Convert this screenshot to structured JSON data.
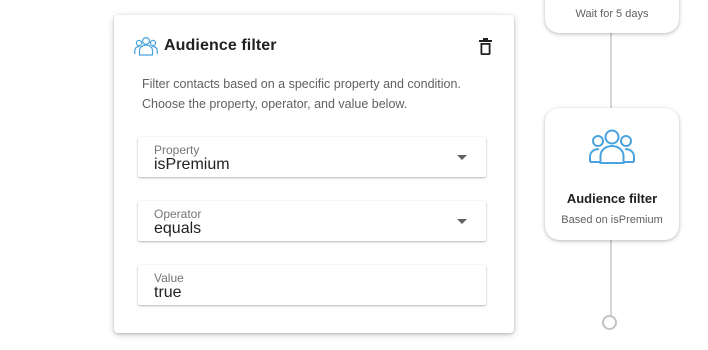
{
  "panel": {
    "title": "Audience filter",
    "description_line1": "Filter contacts based on a specific property and condition.",
    "description_line2": "Choose the property, operator, and value below.",
    "fields": [
      {
        "label": "Property",
        "value": "isPremium",
        "type": "dropdown"
      },
      {
        "label": "Operator",
        "value": "equals",
        "type": "dropdown"
      },
      {
        "label": "Value",
        "value": "true",
        "type": "text"
      }
    ],
    "icons": {
      "header": "audience-icon",
      "delete": "trash-icon"
    }
  },
  "flow": {
    "wait_node": {
      "subtitle": "Wait for 5 days"
    },
    "audience_node": {
      "title": "Audience filter",
      "subtitle": "Based on isPremium",
      "icon": "audience-icon"
    },
    "accent_color": "#4aa3df"
  }
}
